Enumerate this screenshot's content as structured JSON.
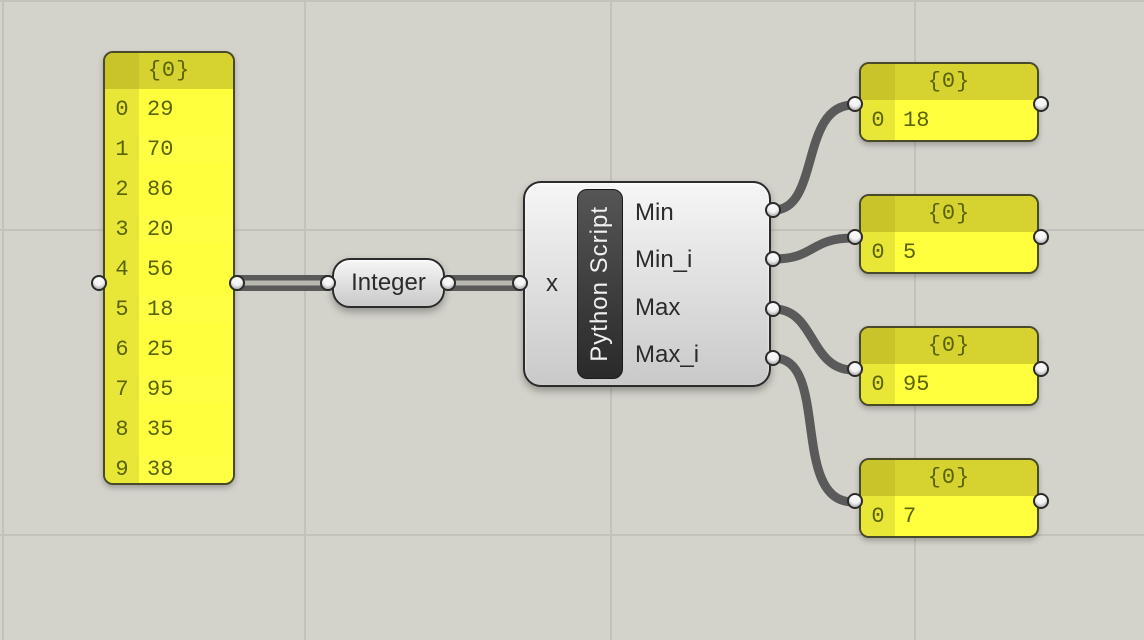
{
  "inputPanel": {
    "branch": "{0}",
    "rows": [
      {
        "index": 0,
        "value": 29
      },
      {
        "index": 1,
        "value": 70
      },
      {
        "index": 2,
        "value": 86
      },
      {
        "index": 3,
        "value": 20
      },
      {
        "index": 4,
        "value": 56
      },
      {
        "index": 5,
        "value": 18
      },
      {
        "index": 6,
        "value": 25
      },
      {
        "index": 7,
        "value": 95
      },
      {
        "index": 8,
        "value": 35
      },
      {
        "index": 9,
        "value": 38
      }
    ]
  },
  "integer": {
    "label": "Integer"
  },
  "python": {
    "name": "Python Script",
    "inputs": [
      "x"
    ],
    "outputs": [
      "Min",
      "Min_i",
      "Max",
      "Max_i"
    ]
  },
  "outputPanels": [
    {
      "branch": "{0}",
      "label": "Min",
      "value": 18
    },
    {
      "branch": "{0}",
      "label": "Min_i",
      "value": 5
    },
    {
      "branch": "{0}",
      "label": "Max",
      "value": 95
    },
    {
      "branch": "{0}",
      "label": "Max_i",
      "value": 7
    }
  ],
  "colors": {
    "panel": "#ffff3e",
    "panelHeader": "#d6d22f",
    "canvas": "#d4d3cb",
    "wire": "#5a5a5a"
  }
}
